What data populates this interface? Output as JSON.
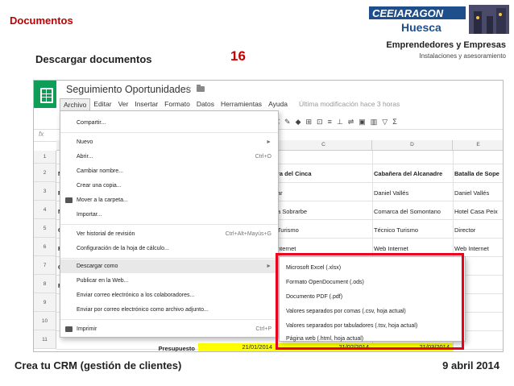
{
  "slide": {
    "title": "Documentos",
    "subtitle": "Descargar documentos",
    "number": "16",
    "brand_line1": "Emprendedores y Empresas",
    "brand_line2": "Instalaciones y asesoramiento",
    "logo_text_1": "CEEIARAGON",
    "logo_text_2": "Huesca",
    "footer_left": "Crea tu CRM (gestión de clientes)",
    "footer_right": "9 abril 2014"
  },
  "colors": {
    "accent_red": "#c00000",
    "sheets_green": "#0f9d58",
    "highlight_box": "#e8001c",
    "budget_fill": "#ffff00"
  },
  "app": {
    "doc_title": "Seguimiento Oportunidades",
    "menubar": [
      "Archivo",
      "Editar",
      "Ver",
      "Insertar",
      "Formato",
      "Datos",
      "Herramientas",
      "Ayuda"
    ],
    "last_modified": "Última modificación hace 3 horas",
    "formula_label": "fx",
    "column_headers": [
      "C",
      "D",
      "E"
    ],
    "row_numbers": [
      "1",
      "2",
      "3",
      "4",
      "5",
      "6",
      "7",
      "8",
      "9",
      "10",
      "11"
    ],
    "left_cells": [
      "N",
      "F",
      "N",
      "C",
      "F",
      "C",
      "F"
    ],
    "rows": [
      [
        "ra del Cinca",
        "Cabañera del Alcanadre",
        "Batalla de Sope"
      ],
      [
        "ar",
        "Daniel Vallés",
        "Daniel Vallés"
      ],
      [
        "a Sobrarbe",
        "Comarca del Somontano",
        "Hotel Casa Peix"
      ],
      [
        "Turismo",
        "Técnico Turismo",
        "Director"
      ],
      [
        "nternet",
        "Web Internet",
        "Web Internet"
      ]
    ],
    "budget_row": {
      "label": "Presupuesto",
      "d1": "21/01/2014",
      "d2": "21/02/2014",
      "d3": "21/03/2014"
    }
  },
  "file_menu": {
    "items": [
      {
        "label": "Compartir...",
        "shortcut": ""
      },
      {
        "label": "Nuevo",
        "shortcut": "►"
      },
      {
        "label": "Abrir...",
        "shortcut": "Ctrl+O"
      },
      {
        "label": "Cambiar nombre...",
        "shortcut": ""
      },
      {
        "label": "Crear una copia...",
        "shortcut": ""
      },
      {
        "label": "Mover a la carpeta...",
        "shortcut": ""
      },
      {
        "label": "Importar...",
        "shortcut": ""
      },
      {
        "label": "Ver historial de revisión",
        "shortcut": "Ctrl+Alt+Mayús+G"
      },
      {
        "label": "Configuración de la hoja de cálculo...",
        "shortcut": ""
      },
      {
        "label": "Descargar como",
        "shortcut": "►"
      },
      {
        "label": "Publicar en la Web...",
        "shortcut": ""
      },
      {
        "label": "Enviar correo electrónico a los colaboradores...",
        "shortcut": ""
      },
      {
        "label": "Enviar por correo electrónico como archivo adjunto...",
        "shortcut": ""
      },
      {
        "label": "Imprimir",
        "shortcut": "Ctrl+P"
      }
    ]
  },
  "download_submenu": {
    "items": [
      "Microsoft Excel (.xlsx)",
      "Formato OpenDocument (.ods)",
      "Documento PDF (.pdf)",
      "Valores separados por comas (.csv, hoja actual)",
      "Valores separados por tabuladores (.tsv, hoja actual)",
      "Página web (.html, hoja actual)"
    ]
  }
}
